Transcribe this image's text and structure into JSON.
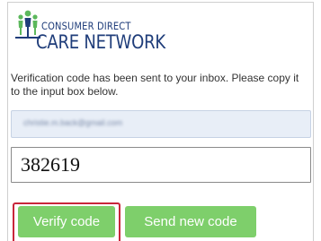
{
  "brand": {
    "line1": "CONSUMER DIRECT",
    "line2": "CARE NETWORK",
    "logo_icon": "people-group-logo-icon",
    "logo_colors": {
      "green": "#5cb85c",
      "navy": "#1f3d7a"
    }
  },
  "message": "Verification code has been sent to your inbox. Please copy it to the input box below.",
  "email_field": {
    "value": "christie.m.back@gmail.com",
    "blurred": true
  },
  "code_input": {
    "value": "382619"
  },
  "buttons": {
    "verify_label": "Verify code",
    "send_new_label": "Send new code",
    "color": "#7ecf6b",
    "highlight_color": "#c8263a"
  }
}
